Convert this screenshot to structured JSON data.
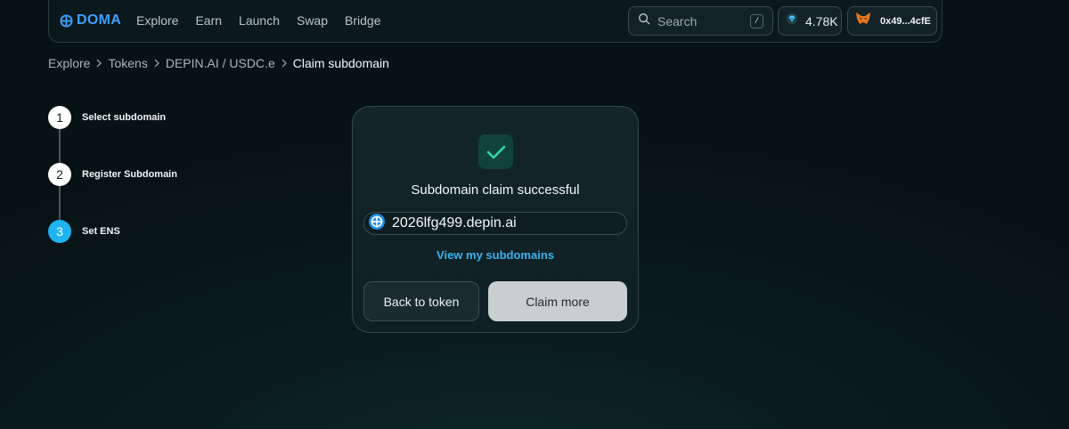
{
  "header": {
    "logo_text": "DOMA",
    "nav": [
      "Explore",
      "Earn",
      "Launch",
      "Swap",
      "Bridge"
    ],
    "search": {
      "placeholder": "Search",
      "shortcut": "/"
    },
    "points": "4.78K",
    "wallet": "0x49...4cfE"
  },
  "breadcrumb": [
    "Explore",
    "Tokens",
    "DEPIN.AI / USDC.e",
    "Claim subdomain"
  ],
  "steps": [
    {
      "num": "1",
      "label": "Select subdomain"
    },
    {
      "num": "2",
      "label": "Register Subdomain"
    },
    {
      "num": "3",
      "label": "Set ENS"
    }
  ],
  "card": {
    "title": "Subdomain claim successful",
    "domain": "2026lfg499.depin.ai",
    "view_link": "View my subdomains",
    "back_button": "Back to token",
    "claim_button": "Claim more"
  },
  "colors": {
    "accent": "#1fb4ef",
    "link": "#3ab2f0",
    "success": "#2fd6a4"
  }
}
